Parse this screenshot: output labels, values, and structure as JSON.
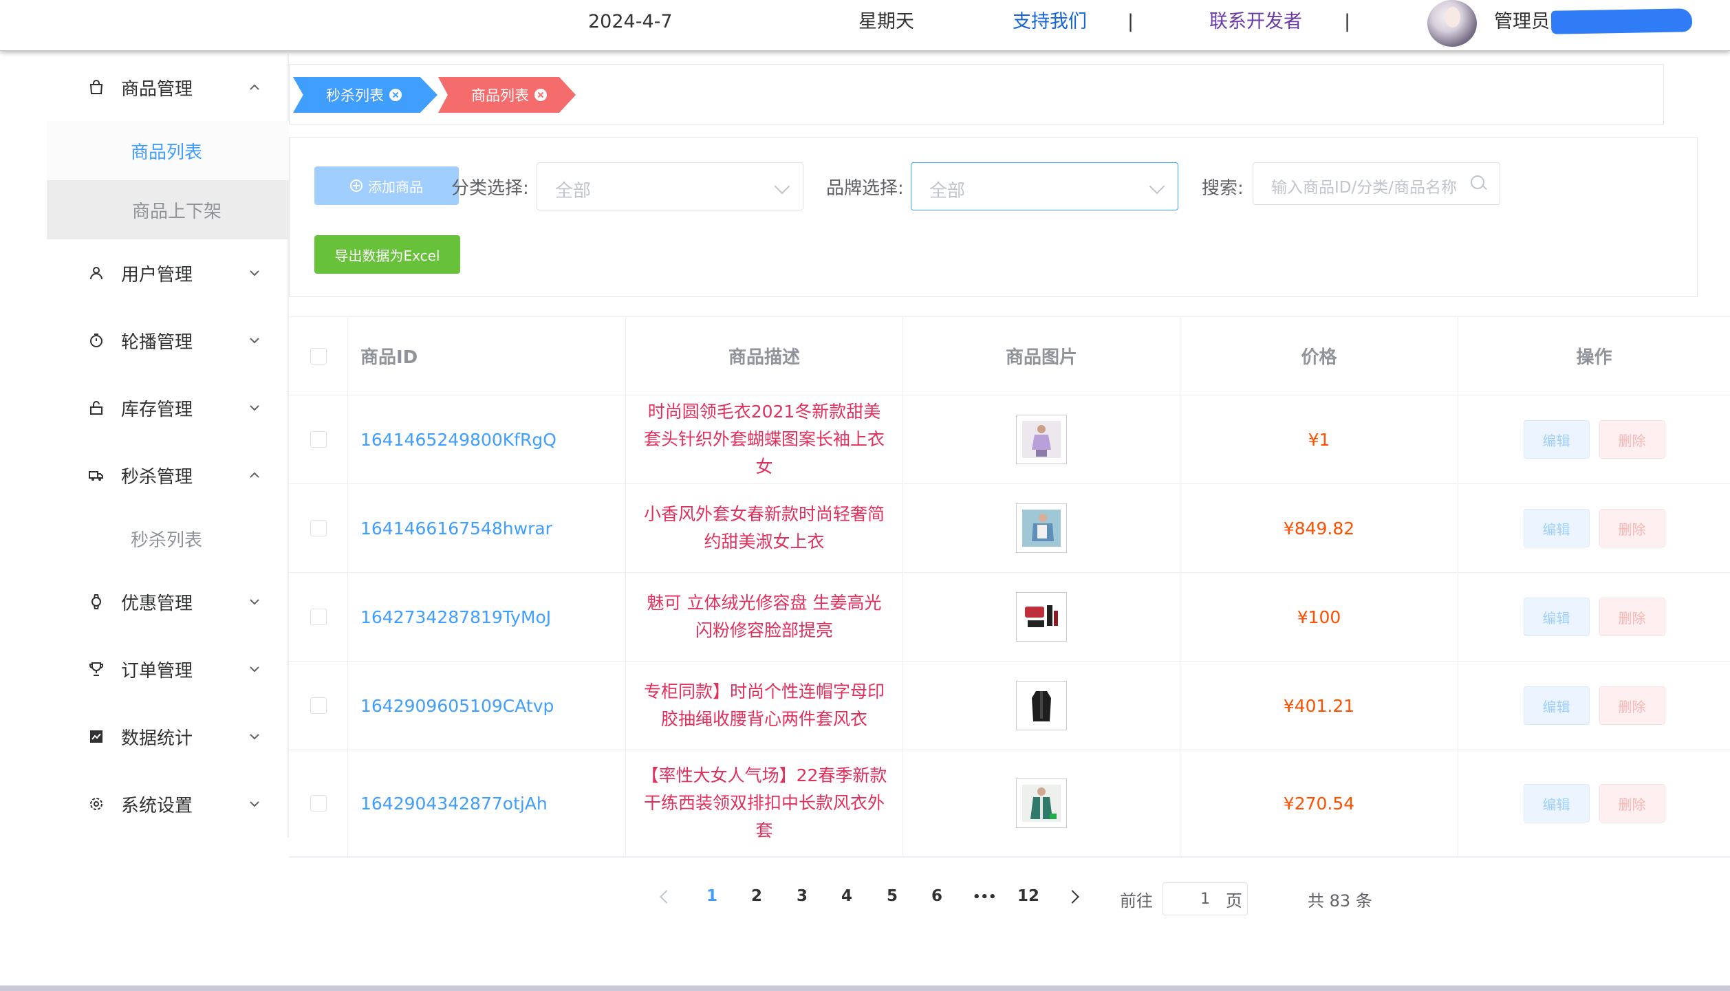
{
  "header": {
    "date": "2024-4-7",
    "weekday": "星期天",
    "support_link": "支持我们",
    "separator": "|",
    "contact_link": "联系开发者",
    "admin_label": "管理员:"
  },
  "sidebar": {
    "menus": [
      {
        "label": "商品管理",
        "icon": "shopping-bag-icon",
        "expanded": true
      },
      {
        "label": "用户管理",
        "icon": "user-icon",
        "expanded": false
      },
      {
        "label": "轮播管理",
        "icon": "timer-icon",
        "expanded": false
      },
      {
        "label": "库存管理",
        "icon": "unlock-icon",
        "expanded": false
      },
      {
        "label": "秒杀管理",
        "icon": "truck-icon",
        "expanded": true
      },
      {
        "label": "优惠管理",
        "icon": "watch-icon",
        "expanded": false
      },
      {
        "label": "订单管理",
        "icon": "trophy-icon",
        "expanded": false
      },
      {
        "label": "数据统计",
        "icon": "chart-icon",
        "expanded": false
      },
      {
        "label": "系统设置",
        "icon": "gear-icon",
        "expanded": false
      }
    ],
    "goods_sub": [
      "商品列表",
      "商品上下架"
    ],
    "seckill_sub": [
      "秒杀列表"
    ]
  },
  "tags": [
    {
      "label": "秒杀列表",
      "color": "#409eff"
    },
    {
      "label": "商品列表",
      "color": "#f56c6c"
    }
  ],
  "filter": {
    "add_button": "添加商品",
    "export_button": "导出数据为Excel",
    "category_label": "分类选择:",
    "category_value": "全部",
    "brand_label": "品牌选择:",
    "brand_value": "全部",
    "search_label": "搜索:",
    "search_placeholder": "输入商品ID/分类/商品名称"
  },
  "table": {
    "columns": [
      "商品ID",
      "商品描述",
      "商品图片",
      "价格",
      "操作"
    ],
    "edit_label": "编辑",
    "delete_label": "删除",
    "rows": [
      {
        "id": "1641465249800KfRgQ",
        "desc": "时尚圆领毛衣2021冬新款甜美套头针织外套蝴蝶图案长袖上衣女",
        "price": "¥1",
        "thumb": "lavender-outfit"
      },
      {
        "id": "1641466167548hwrar",
        "desc": "小香风外套女春新款时尚轻奢简约甜美淑女上衣",
        "price": "¥849.82",
        "thumb": "blue-jacket"
      },
      {
        "id": "1642734287819TyMoJ",
        "desc": "魅可 立体绒光修容盘 生姜高光闪粉修容脸部提亮",
        "price": "¥100",
        "thumb": "makeup-kit"
      },
      {
        "id": "1642909605109CAtvp",
        "desc": "专柜同款】时尚个性连帽字母印胶抽绳收腰背心两件套风衣",
        "price": "¥401.21",
        "thumb": "black-coat"
      },
      {
        "id": "1642904342877otjAh",
        "desc": "【率性大女人气场】22春季新款干练西装领双排扣中长款风衣外套",
        "price": "¥270.54",
        "thumb": "green-coat"
      }
    ]
  },
  "pagination": {
    "pages": [
      "1",
      "2",
      "3",
      "4",
      "5",
      "6",
      "•••",
      "12"
    ],
    "current": "1",
    "goto_label": "前往",
    "goto_value": "1",
    "page_suffix": "页",
    "total": "共 83 条"
  }
}
